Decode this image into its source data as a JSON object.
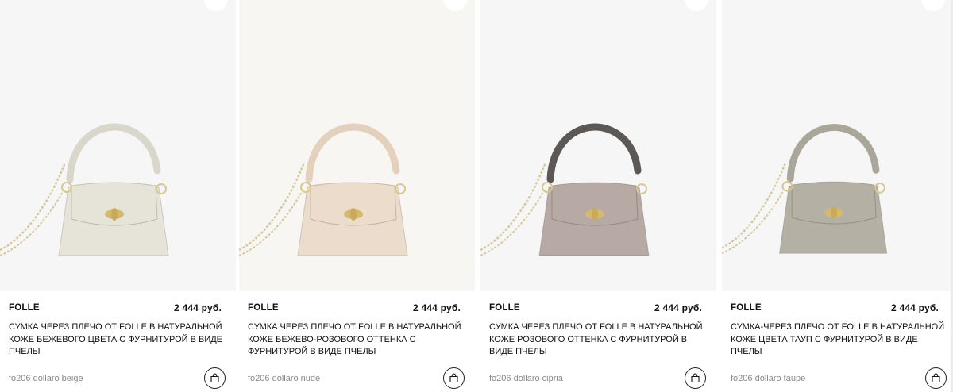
{
  "products": [
    {
      "brand": "FOLLE",
      "price": "2 444 руб.",
      "title": "СУМКА ЧЕРЕЗ ПЛЕЧО ОТ FOLLE В НАТУРАЛЬНОЙ КОЖЕ БЕЖЕВОГО ЦВЕТА С ФУРНИТУРОЙ В ВИДЕ ПЧЕЛЫ",
      "sku": "fo206 dollaro beige",
      "bag_color": "#e6e3d9",
      "handle_color": "#d9d6cc",
      "icons": {
        "favorite": "heart-icon",
        "cart": "shopping-bag-icon"
      }
    },
    {
      "brand": "FOLLE",
      "price": "2 444 руб.",
      "title": "СУМКА ЧЕРЕЗ ПЛЕЧО ОТ FOLLE В НАТУРАЛЬНОЙ КОЖЕ БЕЖЕВО-РОЗОВОГО ОТТЕНКА С ФУРНИТУРОЙ В ВИДЕ ПЧЕЛЫ",
      "sku": "fo206 dollaro nude",
      "bag_color": "#ecdccb",
      "handle_color": "#e3d0bd",
      "icons": {
        "favorite": "heart-icon",
        "cart": "shopping-bag-icon"
      }
    },
    {
      "brand": "FOLLE",
      "price": "2 444 руб.",
      "title": "СУМКА ЧЕРЕЗ ПЛЕЧО ОТ FOLLE В НАТУРАЛЬНОЙ КОЖЕ РОЗОВОГО ОТТЕНКА С ФУРНИТУРОЙ В ВИДЕ ПЧЕЛЫ",
      "sku": "fo206 dollaro cipria",
      "bag_color": "#b7a9a4",
      "handle_color": "#5b5856",
      "icons": {
        "favorite": "heart-icon",
        "cart": "shopping-bag-icon"
      }
    },
    {
      "brand": "FOLLE",
      "price": "2 444 руб.",
      "title": "СУМКА-ЧЕРЕЗ ПЛЕЧО ОТ FOLLE В НАТУРАЛЬНОЙ КОЖЕ ЦВЕТА ТАУП С ФУРНИТУРОЙ В ВИДЕ ПЧЕЛЫ",
      "sku": "fo206 dollaro taupe",
      "bag_color": "#b4b0a3",
      "handle_color": "#aaa699",
      "icons": {
        "favorite": "heart-icon",
        "cart": "shopping-bag-icon"
      }
    }
  ]
}
